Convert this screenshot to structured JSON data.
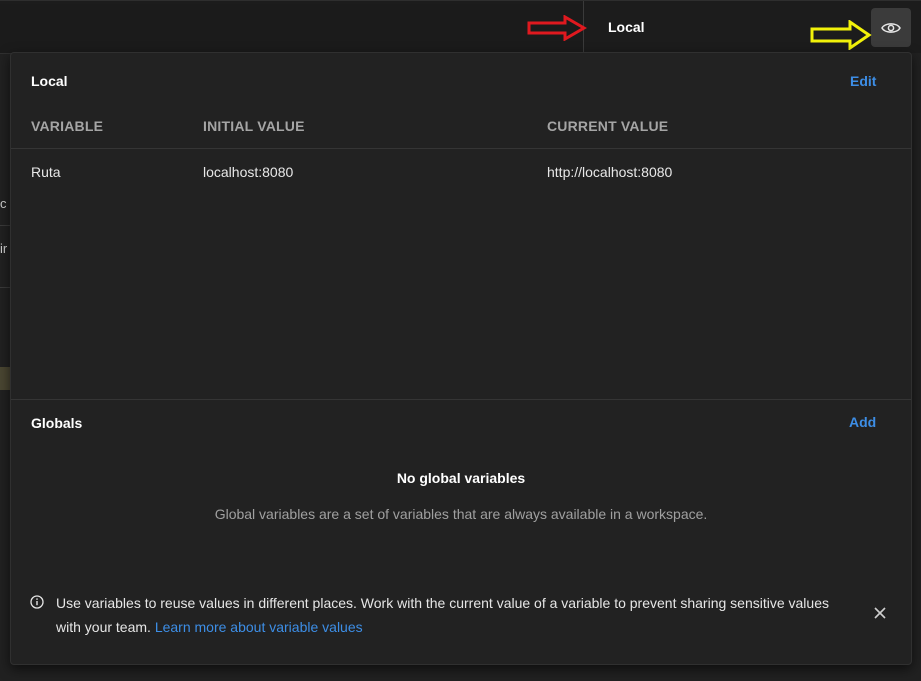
{
  "environment": {
    "selected_name": "Local"
  },
  "local_section": {
    "title": "Local",
    "edit_label": "Edit",
    "columns": [
      "VARIABLE",
      "INITIAL VALUE",
      "CURRENT VALUE"
    ],
    "rows": [
      {
        "variable": "Ruta",
        "initial_value": "localhost:8080",
        "current_value": "http://localhost:8080"
      }
    ]
  },
  "globals_section": {
    "title": "Globals",
    "add_label": "Add",
    "empty_title": "No global variables",
    "empty_description": "Global variables are a set of variables that are always available in a workspace."
  },
  "info_banner": {
    "text": "Use variables to reuse values in different places. Work with the current value of a variable to prevent sharing sensitive values with your team.",
    "link_text": "Learn more about variable values"
  },
  "background": {
    "fragment_1": "c",
    "fragment_2": "ir"
  },
  "icons": {
    "eye": "eye-icon",
    "info": "info-icon",
    "close": "close-icon"
  },
  "colors": {
    "accent": "#3d8ee6",
    "annotation_red": "#e0191f",
    "annotation_yellow": "#f2f20a",
    "annotation_orange": "#f08a1c"
  }
}
